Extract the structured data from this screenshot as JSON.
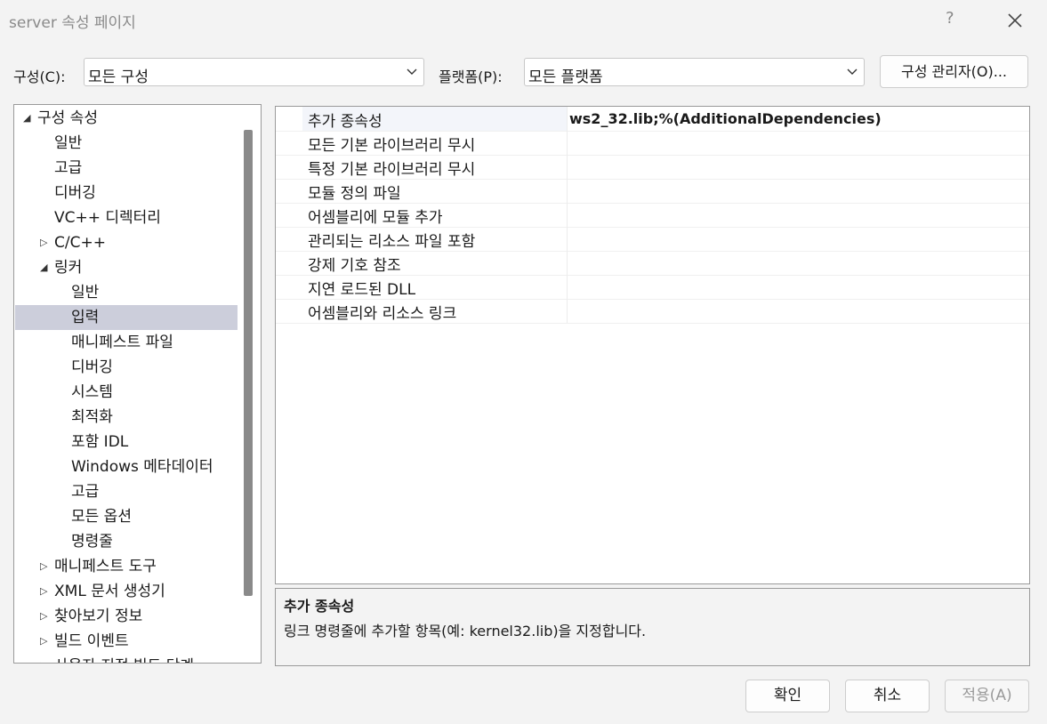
{
  "window": {
    "title": "server 속성 페이지",
    "help_label": "?"
  },
  "toolbar": {
    "config_label": "구성(C):",
    "config_value": "모든 구성",
    "platform_label": "플랫폼(P):",
    "platform_value": "모든 플랫폼",
    "config_manager_label": "구성 관리자(O)..."
  },
  "tree": {
    "items": [
      {
        "label": "구성 속성",
        "expander": "◢"
      },
      {
        "label": "일반",
        "expander": ""
      },
      {
        "label": "고급",
        "expander": ""
      },
      {
        "label": "디버깅",
        "expander": ""
      },
      {
        "label": "VC++ 디렉터리",
        "expander": ""
      },
      {
        "label": "C/C++",
        "expander": "▷"
      },
      {
        "label": "링커",
        "expander": "◢"
      },
      {
        "label": "일반",
        "expander": ""
      },
      {
        "label": "입력",
        "expander": "",
        "selected": true
      },
      {
        "label": "매니페스트 파일",
        "expander": ""
      },
      {
        "label": "디버깅",
        "expander": ""
      },
      {
        "label": "시스템",
        "expander": ""
      },
      {
        "label": "최적화",
        "expander": ""
      },
      {
        "label": "포함 IDL",
        "expander": ""
      },
      {
        "label": "Windows 메타데이터",
        "expander": ""
      },
      {
        "label": "고급",
        "expander": ""
      },
      {
        "label": "모든 옵션",
        "expander": ""
      },
      {
        "label": "명령줄",
        "expander": ""
      },
      {
        "label": "매니페스트 도구",
        "expander": "▷"
      },
      {
        "label": "XML 문서 생성기",
        "expander": "▷"
      },
      {
        "label": "찾아보기 정보",
        "expander": "▷"
      },
      {
        "label": "빌드 이벤트",
        "expander": "▷"
      },
      {
        "label": "사용자 지정 빌드 단계",
        "expander": "▷"
      }
    ]
  },
  "properties": [
    {
      "name": "추가 종속성",
      "value": "ws2_32.lib;%(AdditionalDependencies)"
    },
    {
      "name": "모든 기본 라이브러리 무시",
      "value": ""
    },
    {
      "name": "특정 기본 라이브러리 무시",
      "value": ""
    },
    {
      "name": "모듈 정의 파일",
      "value": ""
    },
    {
      "name": "어셈블리에 모듈 추가",
      "value": ""
    },
    {
      "name": "관리되는 리소스 파일 포함",
      "value": ""
    },
    {
      "name": "강제 기호 참조",
      "value": ""
    },
    {
      "name": "지연 로드된 DLL",
      "value": ""
    },
    {
      "name": "어셈블리와 리소스 링크",
      "value": ""
    }
  ],
  "description": {
    "title": "추가 종속성",
    "text": "링크 명령줄에 추가할 항목(예: kernel32.lib)을 지정합니다."
  },
  "buttons": {
    "ok": "확인",
    "cancel": "취소",
    "apply": "적용(A)"
  }
}
